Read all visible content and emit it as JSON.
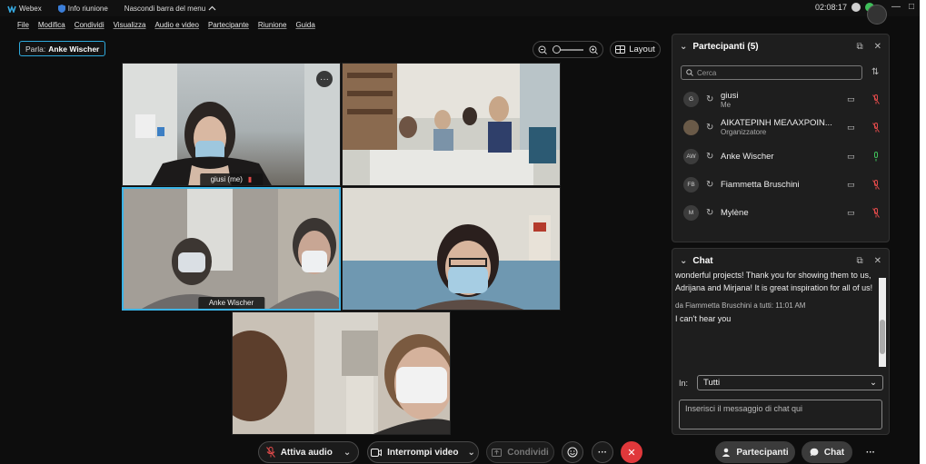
{
  "titlebar": {
    "app_name": "Webex",
    "meeting_info": "Info riunione",
    "hide_menu": "Nascondi barra del menu",
    "clock": "02:08:17"
  },
  "menu": [
    "File",
    "Modifica",
    "Condividi",
    "Visualizza",
    "Audio e video",
    "Partecipante",
    "Riunione",
    "Guida"
  ],
  "speaker": {
    "prefix": "Parla:",
    "name": "Anke Wischer"
  },
  "layout_label": "Layout",
  "tiles": {
    "self_label": "giusi  (me)",
    "active_label": "Anke Wischer"
  },
  "controls": {
    "audio": "Attiva audio",
    "video": "Interrompi video",
    "share": "Condividi",
    "participants": "Partecipanti",
    "chat": "Chat"
  },
  "participants_panel": {
    "title": "Partecipanti (5)",
    "search_placeholder": "Cerca",
    "items": [
      {
        "initials": "G",
        "name": "giusi",
        "role": "Me",
        "muted": true
      },
      {
        "initials": "",
        "name": "ΑΙΚΑΤΕΡΙΝΗ ΜΕΛΑΧΡΟΙΝ...",
        "role": "Organizzatore",
        "muted": true
      },
      {
        "initials": "AW",
        "name": "Anke Wischer",
        "role": "",
        "muted": false
      },
      {
        "initials": "FB",
        "name": "Fiammetta Bruschini",
        "role": "",
        "muted": true
      },
      {
        "initials": "M",
        "name": "Mylène",
        "role": "",
        "muted": true
      }
    ]
  },
  "chat_panel": {
    "title": "Chat",
    "message1": "wonderful projects! Thank you for showing them to us, Adrijana and Mirjana! It is great inspiration for all of us!",
    "meta2": "da Fiammetta Bruschini a tutti:    11:01 AM",
    "message2": "I can't hear you",
    "in_label": "In:",
    "recipient": "Tutti",
    "input_placeholder": "Inserisci il messaggio di chat qui"
  },
  "colors": {
    "accent": "#3cb4e6",
    "danger": "#e0383b",
    "unmuted": "#3fbf5a"
  }
}
